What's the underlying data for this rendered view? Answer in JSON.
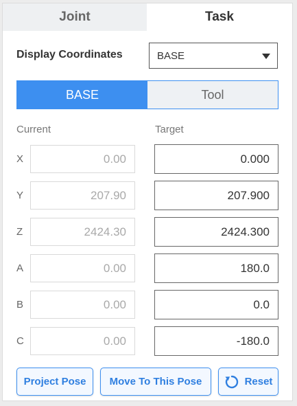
{
  "tabs": {
    "joint": "Joint",
    "task": "Task",
    "active": "Task"
  },
  "display_coordinates": {
    "label": "Display Coordinates",
    "selected": "BASE"
  },
  "frame_toggle": {
    "base": "BASE",
    "tool": "Tool",
    "active": "BASE"
  },
  "headers": {
    "current": "Current",
    "target": "Target"
  },
  "rows": [
    {
      "axis": "X",
      "current": "0.00",
      "target": "0.000"
    },
    {
      "axis": "Y",
      "current": "207.90",
      "target": "207.900"
    },
    {
      "axis": "Z",
      "current": "2424.30",
      "target": "2424.300"
    },
    {
      "axis": "A",
      "current": "0.00",
      "target": "180.0"
    },
    {
      "axis": "B",
      "current": "0.00",
      "target": "0.0"
    },
    {
      "axis": "C",
      "current": "0.00",
      "target": "-180.0"
    }
  ],
  "buttons": {
    "project_pose": "Project Pose",
    "move_to_pose": "Move To This Pose",
    "reset": "Reset"
  },
  "colors": {
    "accent": "#3d8ff0",
    "tab_inactive_bg": "#eef0f2"
  },
  "icons": {
    "reset": "refresh-icon",
    "dropdown": "caret-down-icon"
  }
}
